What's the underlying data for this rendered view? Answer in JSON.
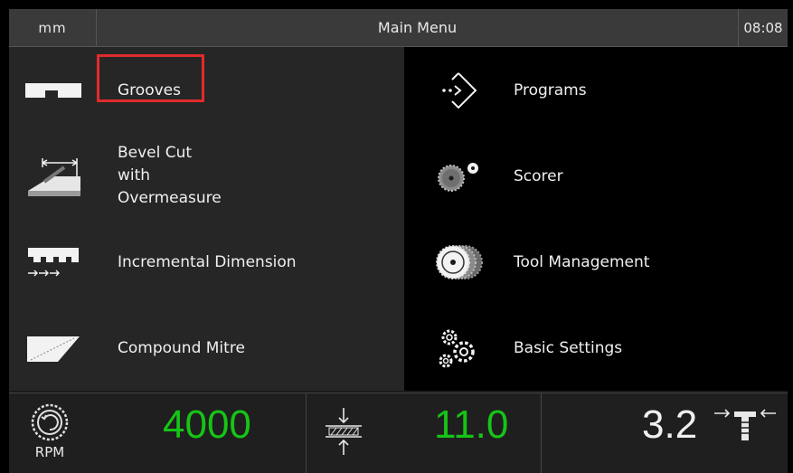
{
  "header": {
    "unit": "mm",
    "title": "Main Menu",
    "time": "08:08"
  },
  "menu": {
    "left": [
      {
        "label": "Grooves",
        "icon": "groove-icon"
      },
      {
        "label": "Bevel Cut\nwith\nOvermeasure",
        "icon": "bevel-cut-icon"
      },
      {
        "label": "Incremental Dimension",
        "icon": "incremental-dimension-icon"
      },
      {
        "label": "Compound Mitre",
        "icon": "compound-mitre-icon"
      }
    ],
    "right": [
      {
        "label": "Programs",
        "icon": "programs-icon"
      },
      {
        "label": "Scorer",
        "icon": "scorer-icon"
      },
      {
        "label": "Tool Management",
        "icon": "tool-management-icon"
      },
      {
        "label": "Basic Settings",
        "icon": "gears-icon"
      }
    ],
    "selected": "Grooves"
  },
  "status": {
    "rpm_label": "RPM",
    "rpm_value": "4000",
    "thickness_value": "11.0",
    "right_value": "3.2"
  },
  "colors": {
    "highlight": "#e12b2b",
    "value_green": "#16c416"
  }
}
